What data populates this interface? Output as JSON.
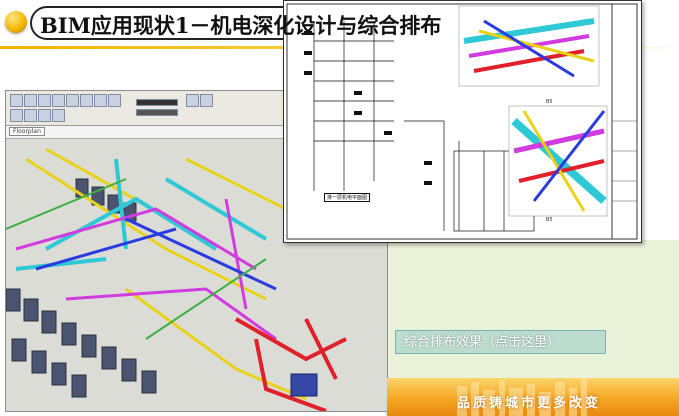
{
  "title": "BIM应用现状1－机电深化设计与综合排布",
  "software": {
    "tab_label": "Floorplan",
    "toolbar_icons": [
      "save-icon",
      "undo-icon",
      "redo-icon",
      "print-icon",
      "cut-icon",
      "copy-icon",
      "paste-icon",
      "measure-icon",
      "align-icon",
      "move-icon",
      "rotate-icon",
      "mirror-icon",
      "line-style-icon",
      "color-icon",
      "filter-icon",
      "zoom-icon"
    ]
  },
  "drawing_sheet": {
    "plan_label": "排一层机电平面图",
    "section_label": "B5",
    "section_label_2": "B5"
  },
  "result_button": {
    "label": "综合排布效果（点击这里）"
  },
  "banner": {
    "text": "品质铸城市更多改变"
  },
  "colors": {
    "accent": "#f0b400",
    "pipe_cyan": "#2ec8d6",
    "pipe_magenta": "#d13be0",
    "pipe_yellow": "#e8d21a",
    "pipe_red": "#e0202a",
    "pipe_blue": "#2a3ce0",
    "banner_orange": "#f5a623"
  }
}
